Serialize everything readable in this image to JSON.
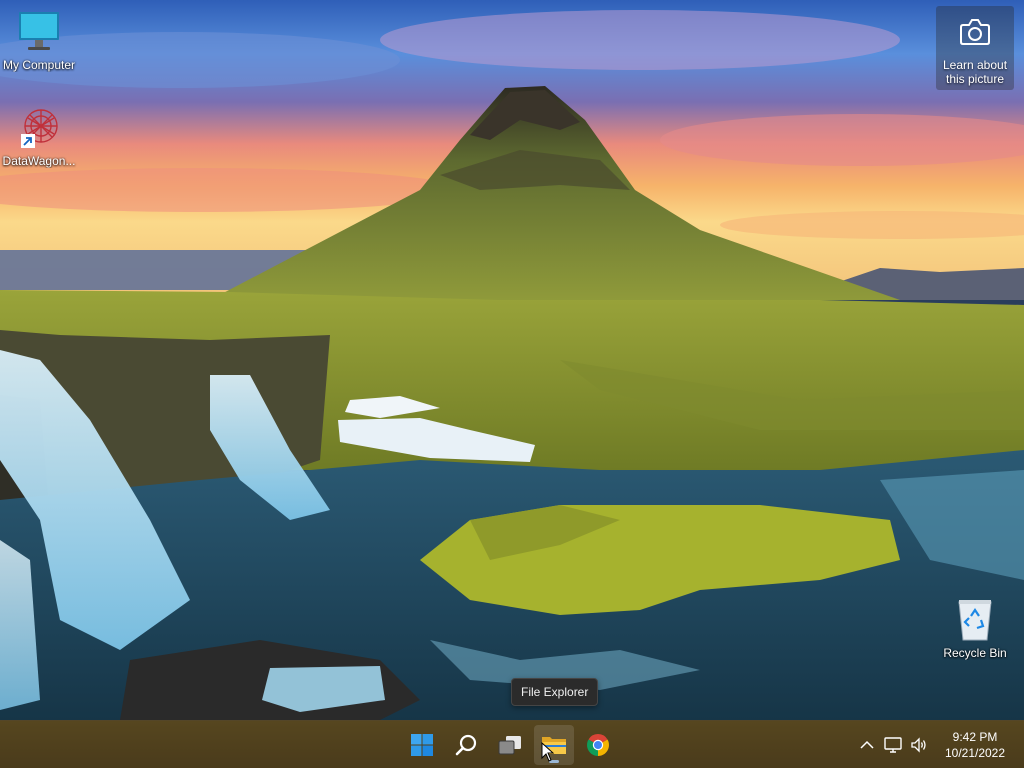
{
  "desktop": {
    "icons": [
      {
        "id": "my-computer",
        "label": "My Computer"
      },
      {
        "id": "datawagon",
        "label": "DataWagon..."
      },
      {
        "id": "recycle-bin",
        "label": "Recycle Bin"
      }
    ],
    "learn_about_picture": {
      "line1": "Learn about",
      "line2": "this picture"
    }
  },
  "tooltip": {
    "text": "File Explorer"
  },
  "taskbar": {
    "items": [
      {
        "name": "start",
        "icon": "windows-logo-icon"
      },
      {
        "name": "search",
        "icon": "search-icon"
      },
      {
        "name": "task-view",
        "icon": "task-view-icon"
      },
      {
        "name": "file-explorer",
        "icon": "folder-icon",
        "active": true
      },
      {
        "name": "chrome",
        "icon": "chrome-icon"
      }
    ],
    "tray": {
      "icons": [
        "chevron-up-icon",
        "network-icon",
        "volume-icon"
      ],
      "time": "9:42 PM",
      "date": "10/21/2022"
    }
  },
  "colors": {
    "taskbar": "#4e3f1f",
    "windows_blue": "#1e90ff",
    "folder_yellow": "#f4c542"
  }
}
